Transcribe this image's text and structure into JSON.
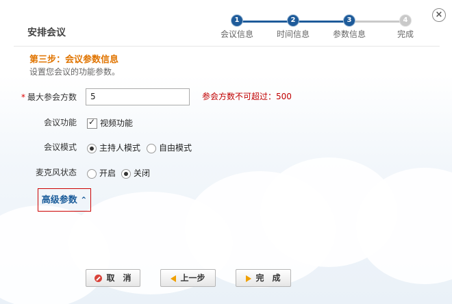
{
  "dialog": {
    "title": "安排会议",
    "close_label": "×"
  },
  "steps": [
    {
      "number": "1",
      "label": "会议信息",
      "state": "done"
    },
    {
      "number": "2",
      "label": "时间信息",
      "state": "done"
    },
    {
      "number": "3",
      "label": "参数信息",
      "state": "current"
    },
    {
      "number": "4",
      "label": "完成",
      "state": "pending"
    }
  ],
  "section": {
    "title": "第三步：会议参数信息",
    "description": "设置您会议的功能参数。"
  },
  "form": {
    "max_participants": {
      "required_mark": "*",
      "label": "最大参会方数",
      "value": "5",
      "hint": "参会方数不可超过：500"
    },
    "meeting_features": {
      "label": "会议功能",
      "video_label": "视频功能",
      "video_checked": true
    },
    "meeting_mode": {
      "label": "会议模式",
      "options": [
        "主持人模式",
        "自由模式"
      ],
      "selected": "主持人模式"
    },
    "mic_state": {
      "label": "麦克风状态",
      "options": [
        "开启",
        "关闭"
      ],
      "selected": "关闭"
    },
    "advanced_label": "高级参数",
    "advanced_icon": "double-chevron-up-icon"
  },
  "buttons": {
    "cancel": "取　消",
    "prev": "上一步",
    "finish": "完　成"
  },
  "colors": {
    "accent_orange": "#e07400",
    "step_active": "#1e5b9a",
    "step_inactive": "#c9c9c9",
    "hint_red": "#c00000",
    "link_blue": "#1a5c9a"
  }
}
